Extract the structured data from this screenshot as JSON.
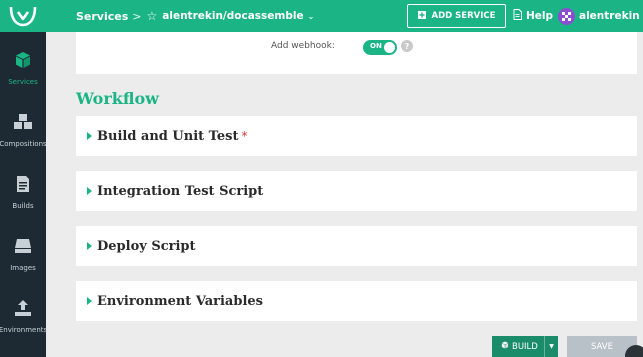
{
  "header": {
    "breadcrumb_root": "Services",
    "breadcrumb_separator": ">",
    "repo_name": "alentrekin/docassemble",
    "add_service_label": "ADD SERVICE",
    "help_label": "Help",
    "username": "alentrekin"
  },
  "sidebar": {
    "items": [
      {
        "label": "Services",
        "icon": "cube-icon",
        "active": true
      },
      {
        "label": "Compositions",
        "icon": "cubes-icon",
        "active": false
      },
      {
        "label": "Builds",
        "icon": "document-icon",
        "active": false
      },
      {
        "label": "Images",
        "icon": "drive-icon",
        "active": false
      },
      {
        "label": "Environments",
        "icon": "upload-icon",
        "active": false
      }
    ]
  },
  "webhook": {
    "label": "Add webhook:",
    "toggle_state": "ON",
    "help_glyph": "?"
  },
  "workflow": {
    "title": "Workflow",
    "sections": [
      {
        "title": "Build and Unit Test",
        "required_mark": "*"
      },
      {
        "title": "Integration Test Script",
        "required_mark": ""
      },
      {
        "title": "Deploy Script",
        "required_mark": ""
      },
      {
        "title": "Environment Variables",
        "required_mark": ""
      }
    ]
  },
  "actions": {
    "build_label": "BUILD",
    "save_label": "SAVE"
  },
  "colors": {
    "accent": "#1bb585",
    "sidebar_bg": "#1e2a33",
    "required": "#e0342f"
  }
}
